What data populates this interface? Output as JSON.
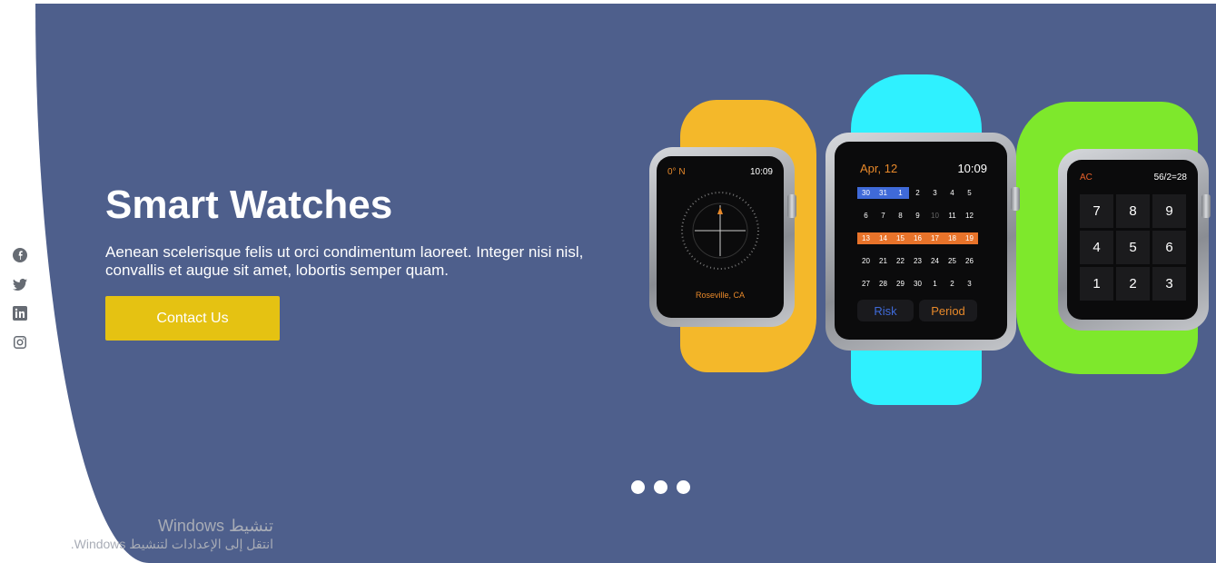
{
  "hero": {
    "title": "Smart Watches",
    "description": "Aenean scelerisque felis ut orci condimentum laoreet. Integer nisi nisl, convallis et augue sit amet, lobortis semper quam.",
    "cta_label": "Contact Us",
    "background_color": "#4e5f8c",
    "cta_color": "#e5c212"
  },
  "social": [
    "facebook-icon",
    "twitter-icon",
    "linkedin-icon",
    "instagram-icon"
  ],
  "carousel": {
    "slides": 3
  },
  "watches": {
    "compass": {
      "heading": "0° N",
      "time": "10:09",
      "location": "Roseville, CA"
    },
    "calendar": {
      "month": "Apr, 12",
      "time": "10:09",
      "days": [
        "30",
        "31",
        "1",
        "2",
        "3",
        "4",
        "5",
        "6",
        "7",
        "8",
        "9",
        "10",
        "11",
        "12",
        "13",
        "14",
        "15",
        "16",
        "17",
        "18",
        "19",
        "20",
        "21",
        "22",
        "23",
        "24",
        "25",
        "26",
        "27",
        "28",
        "29",
        "30",
        "1",
        "2",
        "3"
      ],
      "risk_label": "Risk",
      "period_label": "Period"
    },
    "calculator": {
      "ac_label": "AC",
      "display": "56/2=28",
      "keys": [
        "7",
        "8",
        "9",
        "4",
        "5",
        "6",
        "1",
        "2",
        "3"
      ]
    }
  },
  "watermark": {
    "line1": "تنشيط Windows",
    "line2": "انتقل إلى الإعدادات لتنشيط Windows."
  }
}
